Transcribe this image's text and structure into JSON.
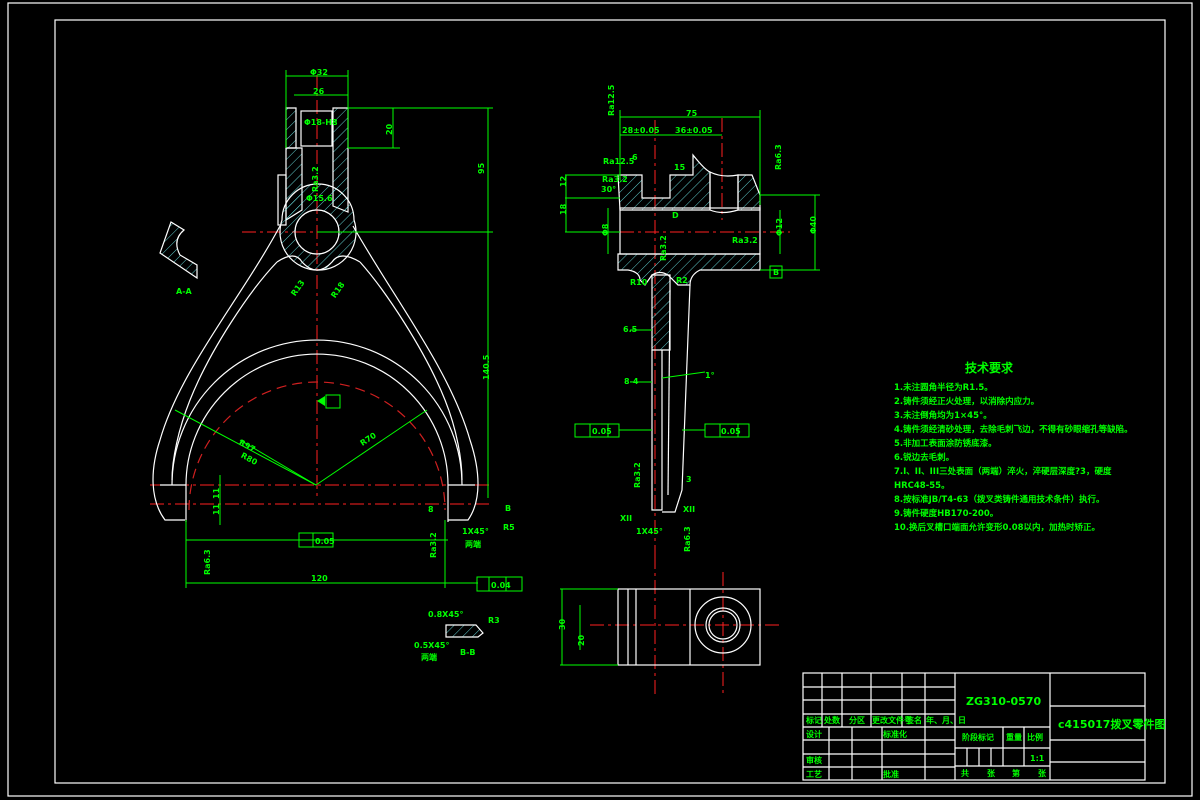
{
  "drawing": {
    "part_number": "ZG310-0570",
    "title": "c415017拨叉零件图",
    "scale": "1:1"
  },
  "title_block": {
    "row_labels": [
      "标记",
      "处数",
      "分区",
      "更改文件号",
      "签名",
      "年、月、日"
    ],
    "design": "设计",
    "standardization": "标准化",
    "review": "审核",
    "process": "工艺",
    "approve": "批准",
    "stage_mark": "阶段标记",
    "weight": "重量",
    "scale_label": "比例",
    "sheets": [
      "共",
      "张",
      "第",
      "张"
    ]
  },
  "requirements": {
    "title": "技术要求",
    "items": [
      "1.未注圆角半径为R1.5。",
      "2.铸件须经正火处理，以消除内应力。",
      "3.未注倒角均为1×45°。",
      "4.铸件须经清砂处理，去除毛刺飞边，不得有砂眼缩孔等缺陷。",
      "5.非加工表面涂防锈底漆。",
      "6.锐边去毛刺。",
      "7.I、II、III三处表面（两端）淬火，淬硬层深度?3，硬度",
      "HRC48-55。",
      "8.按标准JB/T4-63（拨叉类铸件通用技术条件）执行。",
      "9.铸件硬度HB170-200。",
      "10.换后叉槽口端面允许变形0.08以内，加热时矫正。"
    ]
  },
  "front_view": {
    "dims": [
      "Φ32",
      "26",
      "Φ18-H8",
      "20",
      "95",
      "Ra3.2",
      "Φ15.6",
      "R13",
      "R18",
      "140.5",
      "R97",
      "R80",
      "R70",
      "11",
      "11",
      "120",
      "0.05",
      "0.04",
      "1X45°",
      "两端",
      "Ra6.3",
      "Ra3.2",
      "A-A",
      "R5",
      "B",
      "8"
    ],
    "section_dims": [
      "0.8X45°",
      "0.5X45°",
      "两端",
      "B-B",
      "R3"
    ]
  },
  "side_view": {
    "dims": [
      "75",
      "28±0.05",
      "36±0.05",
      "6",
      "15",
      "Ra12.5",
      "Ra3.2",
      "30°",
      "12",
      "18",
      "Ra12.5",
      "Φ40",
      "Φ12",
      "Ra3.2",
      "Ra6.3",
      "R10",
      "Φ8",
      "R2",
      "B",
      "D",
      "6.5",
      "0.05",
      "0.05",
      "8-4",
      "1°",
      "Ra3.2",
      "3",
      "XII",
      "XII",
      "1X45°",
      "Ra6.3",
      "Ra3.2"
    ]
  },
  "bottom_view": {
    "dims": [
      "30",
      "20"
    ]
  }
}
